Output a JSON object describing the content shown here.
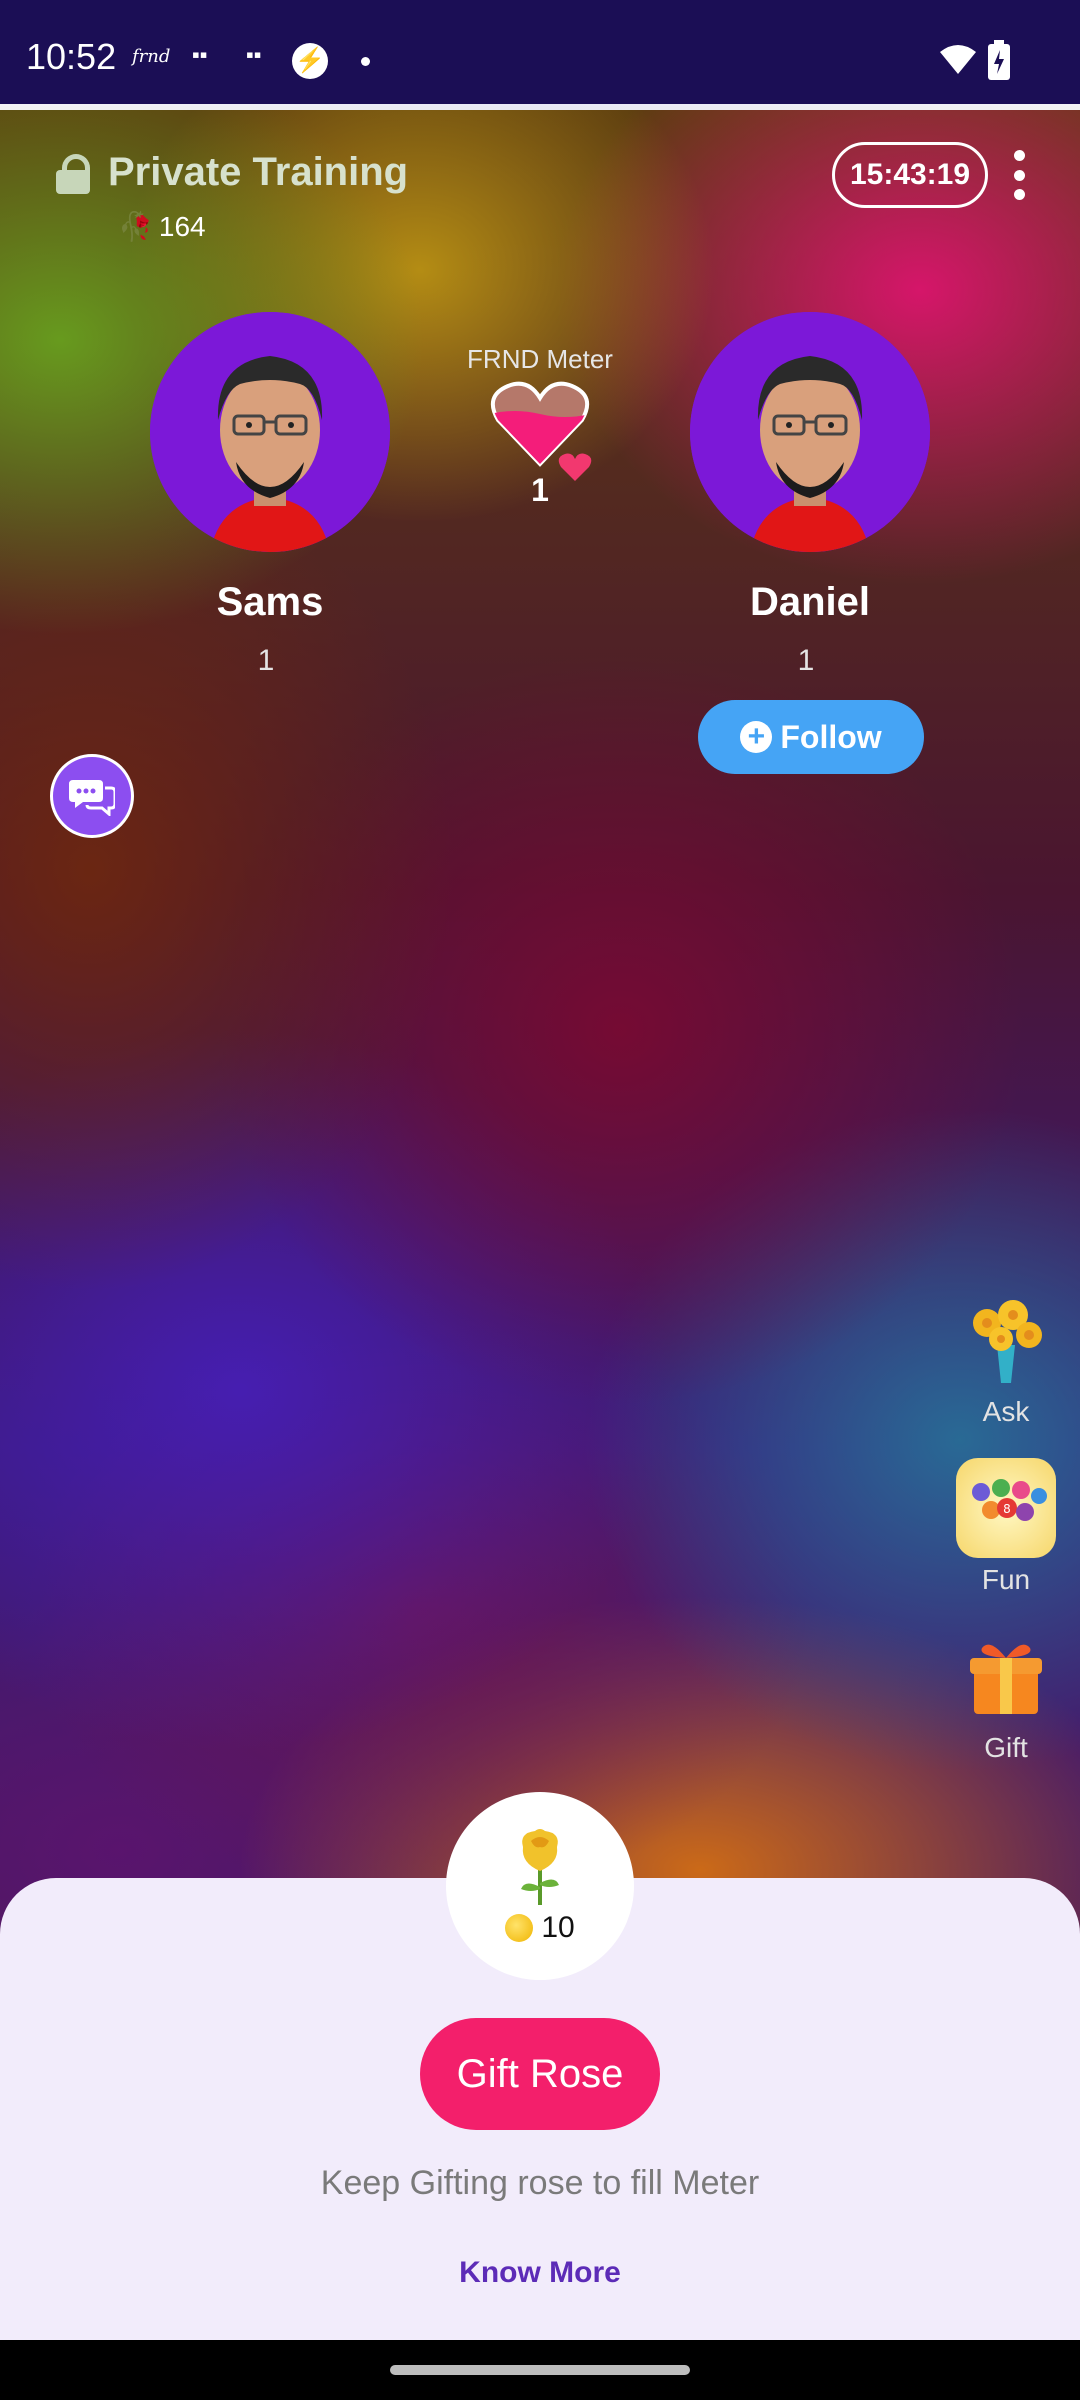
{
  "status_bar": {
    "time": "10:52",
    "notification_icons": [
      "frnd-logo-icon",
      "grid-icon",
      "grid-icon",
      "bolt-icon",
      "dot-icon"
    ],
    "system_icons": [
      "wifi-icon",
      "battery-charging-icon"
    ]
  },
  "header": {
    "room_title": "Private Training",
    "rose_count": "164",
    "timer": "15:43:19"
  },
  "users": {
    "left": {
      "name": "Sams",
      "count": "1"
    },
    "right": {
      "name": "Daniel",
      "count": "1",
      "follow_label": "Follow"
    }
  },
  "meter": {
    "label": "FRND Meter",
    "count": "1",
    "fill_fraction": 0.6
  },
  "side_actions": [
    {
      "label": "Ask",
      "icon": "flower-bouquet-icon"
    },
    {
      "label": "Fun",
      "icon": "bingo-balls-icon"
    },
    {
      "label": "Gift",
      "icon": "gift-box-icon"
    }
  ],
  "sheet": {
    "rose_price": "10",
    "gift_button": "Gift Rose",
    "hint": "Keep Gifting rose to fill Meter",
    "know_more": "Know More"
  },
  "colors": {
    "accent_pink": "#f31f6b",
    "follow_blue": "#45a4f5",
    "avatar_purple": "#7c18d8",
    "link_purple": "#5c2bb7"
  }
}
